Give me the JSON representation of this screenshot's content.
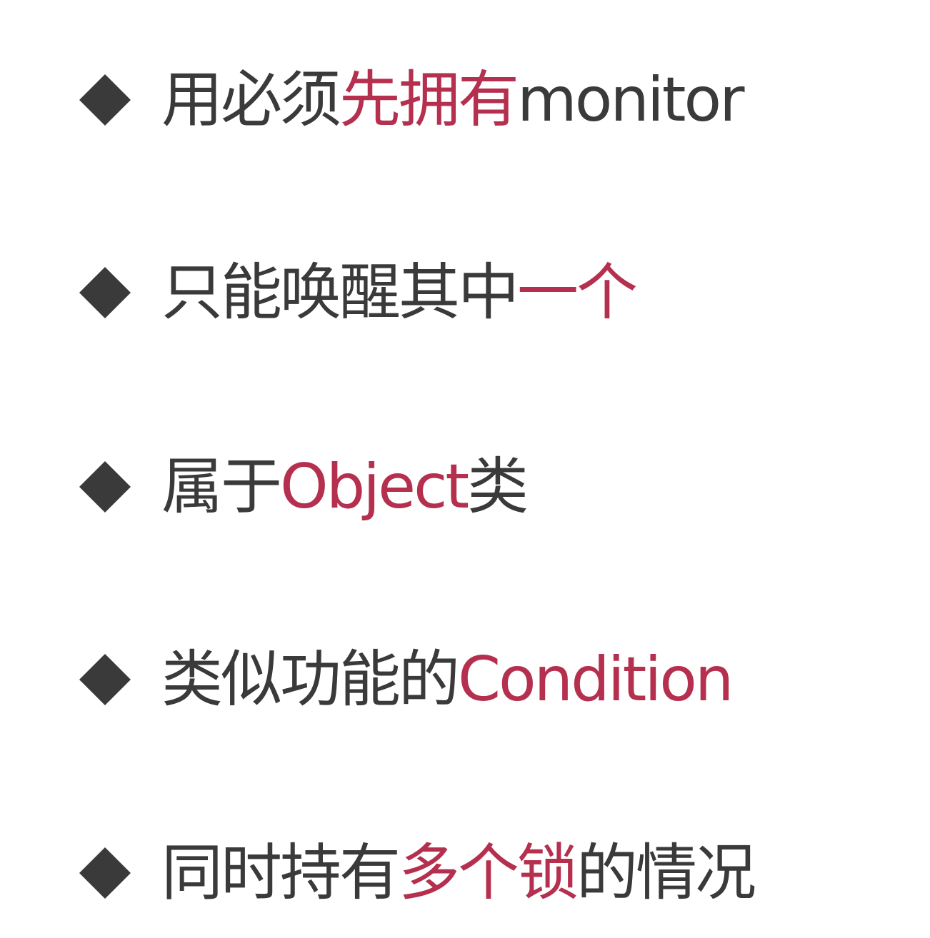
{
  "colors": {
    "text": "#3a3a3a",
    "highlight": "#b5304e",
    "bullet": "#3a3a3a"
  },
  "bullet_icon": "diamond-bullet-icon",
  "items": [
    {
      "segments": [
        {
          "text": "用必须",
          "highlight": false
        },
        {
          "text": "先拥有",
          "highlight": true
        },
        {
          "text": "monitor",
          "highlight": false
        }
      ]
    },
    {
      "segments": [
        {
          "text": "只能唤醒其中",
          "highlight": false
        },
        {
          "text": "一个",
          "highlight": true
        }
      ]
    },
    {
      "segments": [
        {
          "text": "属于",
          "highlight": false
        },
        {
          "text": "Object",
          "highlight": true
        },
        {
          "text": "类",
          "highlight": false
        }
      ]
    },
    {
      "segments": [
        {
          "text": "类似功能的",
          "highlight": false
        },
        {
          "text": "Condition",
          "highlight": true
        }
      ]
    },
    {
      "segments": [
        {
          "text": "同时持有",
          "highlight": false
        },
        {
          "text": "多个锁",
          "highlight": true
        },
        {
          "text": "的情况",
          "highlight": false
        }
      ]
    }
  ]
}
